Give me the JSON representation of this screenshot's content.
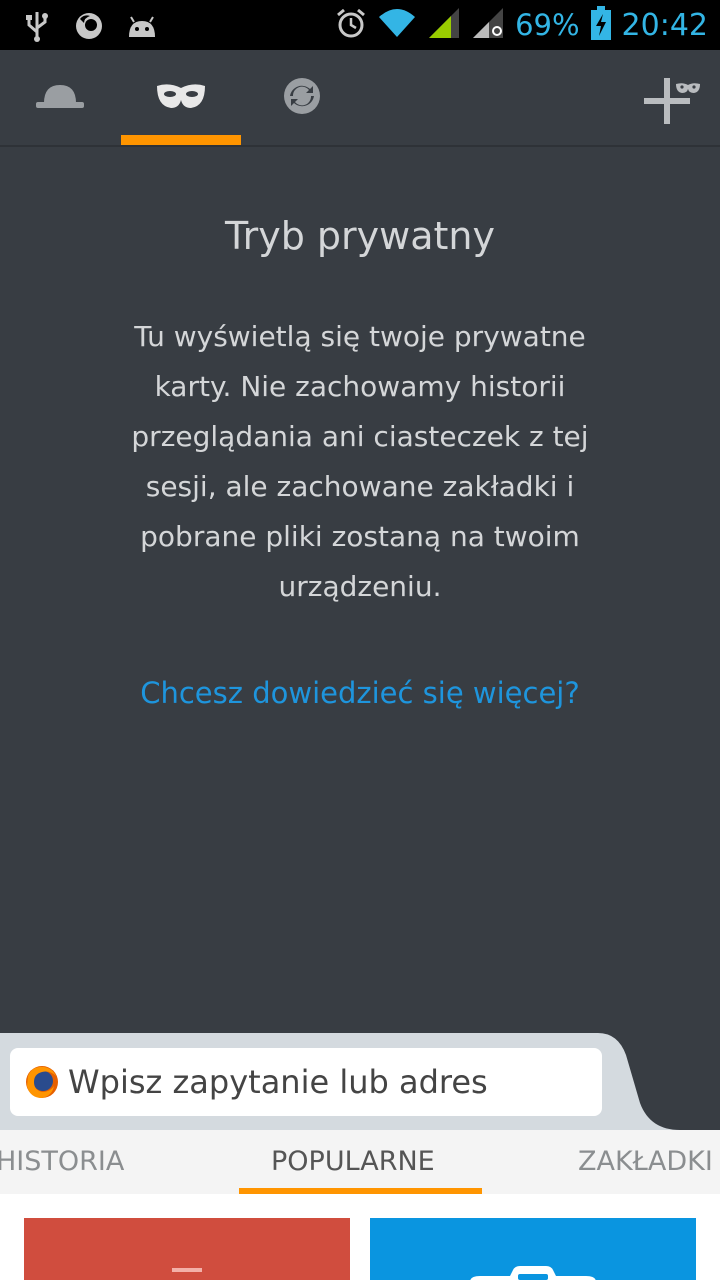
{
  "status_bar": {
    "battery_percent": "69%",
    "time": "20:42",
    "icons": [
      "usb-icon",
      "firefox-icon",
      "android-icon",
      "alarm-icon",
      "wifi-icon",
      "signal-icon",
      "signal-roaming-icon",
      "battery-charging-icon"
    ]
  },
  "tab_bar": {
    "tabs": [
      {
        "name": "normal-tabs",
        "icon": "hat-icon"
      },
      {
        "name": "private-tabs",
        "icon": "mask-icon",
        "active": true
      },
      {
        "name": "synced-tabs",
        "icon": "sync-icon"
      }
    ],
    "add_icon": "add-private-tab-icon"
  },
  "private": {
    "title": "Tryb prywatny",
    "description": "Tu wyświetlą się twoje prywatne karty. Nie zachowamy historii przeglądania ani ciasteczek z tej sesji, ale zachowane zakładki i pobrane pliki zostaną na twoim urządzeniu.",
    "learn_more": "Chcesz dowiedzieć się więcej?"
  },
  "url_bar": {
    "placeholder": "Wpisz zapytanie lub adres"
  },
  "home_tabs": {
    "items": [
      "HISTORIA",
      "POPULARNE",
      "ZAKŁADKI"
    ],
    "active": "POPULARNE"
  },
  "colors": {
    "accent": "#ff9500",
    "link": "#1e95dd",
    "background": "#383d43",
    "status_blue": "#33b5e5",
    "thumb_red": "#d04d3e",
    "thumb_blue": "#0a95e0"
  }
}
